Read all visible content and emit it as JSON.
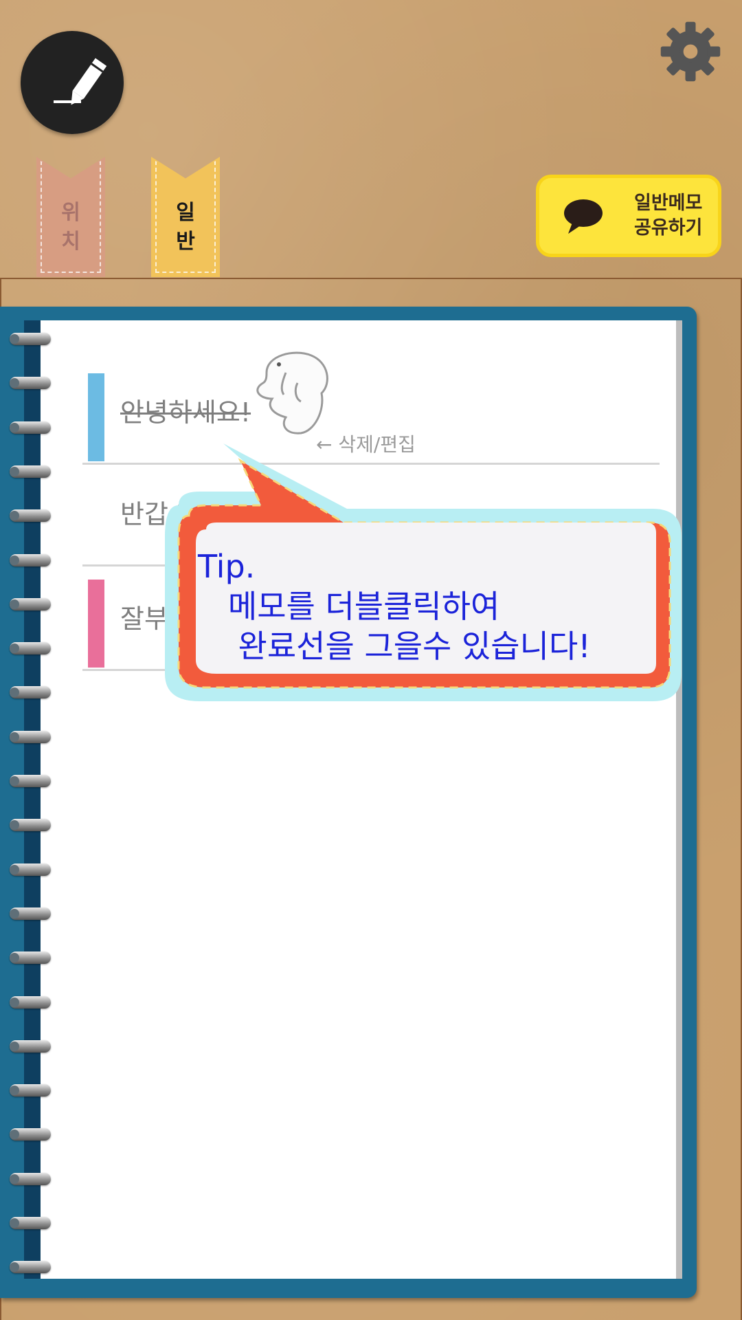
{
  "compose_button": {
    "icon": "pencil-icon"
  },
  "settings_button": {
    "icon": "gear-icon"
  },
  "bookmarks": [
    {
      "label_line1": "위",
      "label_line2": "치",
      "color": "#d79d82"
    },
    {
      "label_line1": "일",
      "label_line2": "반",
      "color": "#f2c35a"
    }
  ],
  "share": {
    "line1": "일반메모",
    "line2": "공유하기",
    "icon": "speech-bubble-icon",
    "color": "#fde43c"
  },
  "memos": [
    {
      "text": "안녕하세요!",
      "done": true,
      "color": "#6cbbe3"
    },
    {
      "text": "반갑습니",
      "done": false,
      "color": ""
    },
    {
      "text": "잘부",
      "done": false,
      "color": "#e96f9a"
    }
  ],
  "hint": "← 삭제/편집",
  "tip": {
    "title": "Tip.",
    "line1": "메모를 더블클릭하여",
    "line2": "완료선을 그을수 있습니다!"
  }
}
